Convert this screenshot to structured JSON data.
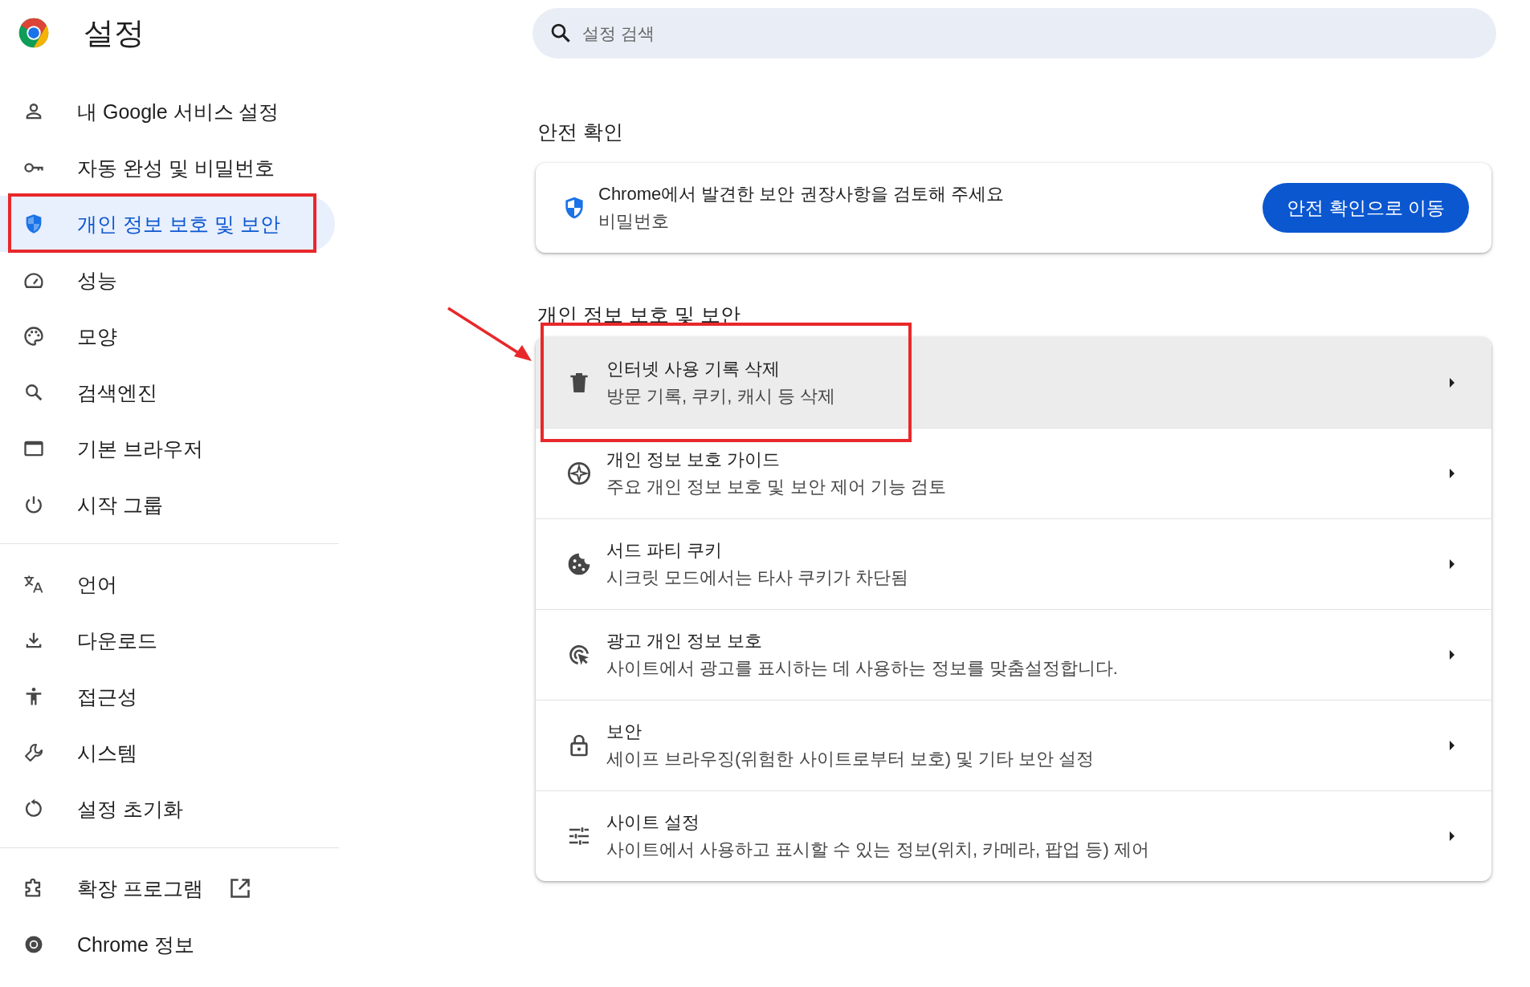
{
  "sidebar": {
    "title": "설정",
    "groups": [
      [
        {
          "label": "내 Google 서비스 설정",
          "selected": false
        },
        {
          "label": "자동 완성 및 비밀번호",
          "selected": false
        },
        {
          "label": "개인 정보 보호 및 보안",
          "selected": true
        },
        {
          "label": "성능",
          "selected": false
        },
        {
          "label": "모양",
          "selected": false
        },
        {
          "label": "검색엔진",
          "selected": false
        },
        {
          "label": "기본 브라우저",
          "selected": false
        },
        {
          "label": "시작 그룹",
          "selected": false
        }
      ],
      [
        {
          "label": "언어",
          "selected": false
        },
        {
          "label": "다운로드",
          "selected": false
        },
        {
          "label": "접근성",
          "selected": false
        },
        {
          "label": "시스템",
          "selected": false
        },
        {
          "label": "설정 초기화",
          "selected": false
        }
      ],
      [
        {
          "label": "확장 프로그램",
          "selected": false
        },
        {
          "label": "Chrome 정보",
          "selected": false
        }
      ]
    ]
  },
  "search": {
    "placeholder": "설정 검색"
  },
  "safety_check": {
    "heading": "안전 확인",
    "title": "Chrome에서 발견한 보안 권장사항을 검토해 주세요",
    "subtitle": "비밀번호",
    "button": "안전 확인으로 이동"
  },
  "privacy": {
    "heading": "개인 정보 보호 및 보안",
    "rows": [
      {
        "title": "인터넷 사용 기록 삭제",
        "subtitle": "방문 기록, 쿠키, 캐시 등 삭제",
        "hovered": true
      },
      {
        "title": "개인 정보 보호 가이드",
        "subtitle": "주요 개인 정보 보호 및 보안 제어 기능 검토",
        "hovered": false
      },
      {
        "title": "서드 파티 쿠키",
        "subtitle": "시크릿 모드에서는 타사 쿠키가 차단됨",
        "hovered": false
      },
      {
        "title": "광고 개인 정보 보호",
        "subtitle": "사이트에서 광고를 표시하는 데 사용하는 정보를 맞춤설정합니다.",
        "hovered": false
      },
      {
        "title": "보안",
        "subtitle": "세이프 브라우징(위험한 사이트로부터 보호) 및 기타 보안 설정",
        "hovered": false
      },
      {
        "title": "사이트 설정",
        "subtitle": "사이트에서 사용하고 표시할 수 있는 정보(위치, 카메라, 팝업 등) 제어",
        "hovered": false
      }
    ]
  }
}
